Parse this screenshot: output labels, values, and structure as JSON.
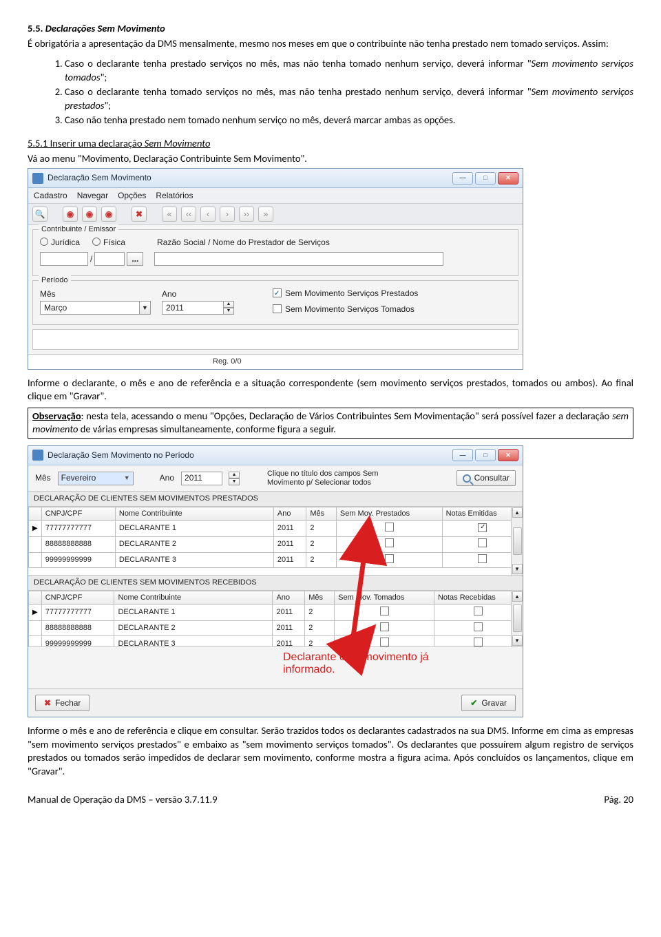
{
  "section": {
    "heading_number": "5.5.",
    "heading_title": "Declarações Sem Movimento",
    "intro": "É obrigatória a apresentação da DMS mensalmente, mesmo nos meses em que o contribuinte não tenha prestado nem tomado serviços. Assim:",
    "item1_a": "Caso o declarante tenha prestado serviços no mês, mas não tenha tomado nenhum serviço, deverá informar \"",
    "item1_b": "Sem movimento serviços tomados",
    "item1_c": "\";",
    "item2_a": "Caso o declarante tenha tomado serviços no mês, mas não tenha prestado nenhum serviço, deverá informar \"",
    "item2_b": "Sem movimento serviços prestados",
    "item2_c": "\";",
    "item3": "Caso não tenha prestado nem tomado nenhum serviço no mês, deverá marcar ambas as opções.",
    "sub_number": "5.5.1",
    "sub_title": "Inserir uma declaração Sem Movimento",
    "sub_text": "Vá ao menu \"Movimento, Declaração Contribuinte Sem Movimento\".",
    "para1": "Informe o declarante, o mês e ano de referência e a situação correspondente (sem movimento serviços prestados, tomados ou ambos). Ao final clique em \"Gravar\".",
    "note_label": "Observação",
    "note_rest": ": nesta tela, acessando o menu \"Opções, Declaração de Vários Contribuintes Sem Movimentação\" será possível fazer a declaração ",
    "note_italic": "sem movimento",
    "note_tail": " de várias empresas simultaneamente, conforme figura a seguir.",
    "para2": "Informe o mês e ano de referência e clique em consultar. Serão trazidos todos os declarantes cadastrados na sua DMS. Informe em cima as empresas \"sem movimento serviços prestados\" e embaixo as \"sem movimento serviços tomados\". Os declarantes que possuírem algum registro de serviços prestados ou tomados serão impedidos de declarar sem movimento, conforme mostra a figura acima. Após concluídos os lançamentos, clique em \"Gravar\"."
  },
  "win1": {
    "title": "Declaração Sem Movimento",
    "menu": [
      "Cadastro",
      "Navegar",
      "Opções",
      "Relatórios"
    ],
    "group1": "Contribuinte / Emissor",
    "radio1": "Jurídica",
    "radio2": "Física",
    "razao_label": "Razão Social / Nome do Prestador de Serviços",
    "slash": "/",
    "dots": "...",
    "group2": "Período",
    "mes_label": "Mês",
    "mes_value": "Março",
    "ano_label": "Ano",
    "ano_value": "2011",
    "cb1": "Sem Movimento Serviços Prestados",
    "cb2": "Sem Movimento Serviços Tomados",
    "reg": "Reg. 0/0"
  },
  "win2": {
    "title": "Declaração Sem Movimento no Período",
    "mes_label": "Mês",
    "mes_value": "Fevereiro",
    "ano_label": "Ano",
    "ano_value": "2011",
    "hint1": "Clique no título dos campos Sem",
    "hint2": "Movimento p/ Selecionar todos",
    "consultar": "Consultar",
    "section_prestados": "DECLARAÇÃO DE CLIENTES SEM MOVIMENTOS PRESTADOS",
    "section_recebidos": "DECLARAÇÃO DE CLIENTES SEM MOVIMENTOS RECEBIDOS",
    "cols_p": [
      "CNPJ/CPF",
      "Nome Contribuinte",
      "Ano",
      "Mês",
      "Sem Mov. Prestados",
      "Notas Emitidas"
    ],
    "cols_r": [
      "CNPJ/CPF",
      "Nome Contribuinte",
      "Ano",
      "Mês",
      "Sem Mov. Tomados",
      "Notas Recebidas"
    ],
    "rows": [
      {
        "cnpj": "77777777777",
        "nome": "DECLARANTE 1",
        "ano": "2011",
        "mes": "2"
      },
      {
        "cnpj": "88888888888",
        "nome": "DECLARANTE 2",
        "ano": "2011",
        "mes": "2"
      },
      {
        "cnpj": "99999999999",
        "nome": "DECLARANTE 3",
        "ano": "2011",
        "mes": "2"
      }
    ],
    "fechar": "Fechar",
    "gravar": "Gravar",
    "callout_a": "Declarante com movimento já",
    "callout_b": "informado."
  },
  "footer": {
    "left": "Manual de Operação da DMS – versão 3.7.11.9",
    "right": "Pág. 20"
  }
}
